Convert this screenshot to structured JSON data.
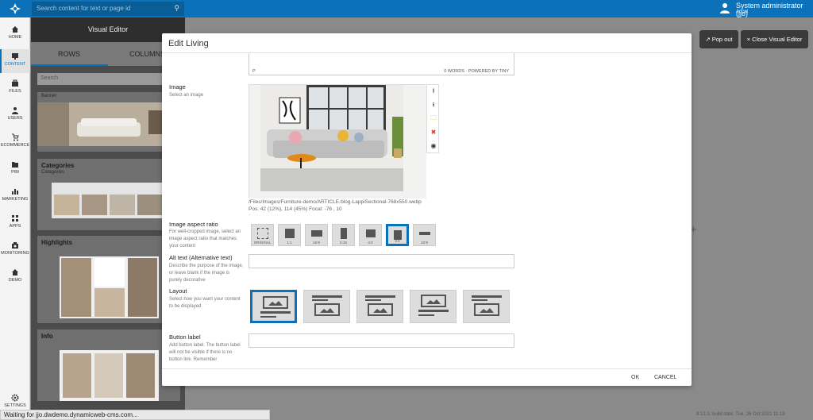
{
  "topbar": {
    "search_placeholder": "Search content for text or page id",
    "user_name": "System administrator (jjo)",
    "user_subtitle": "Angel"
  },
  "nav": [
    {
      "label": "HOME",
      "icon": "home-icon"
    },
    {
      "label": "CONTENT",
      "icon": "monitor-icon",
      "active": true
    },
    {
      "label": "FILES",
      "icon": "briefcase-icon"
    },
    {
      "label": "USERS",
      "icon": "user-icon"
    },
    {
      "label": "ECOMMERCE",
      "icon": "cart-icon"
    },
    {
      "label": "PIM",
      "icon": "folder-icon"
    },
    {
      "label": "MARKETING",
      "icon": "bar-chart-icon"
    },
    {
      "label": "APPS",
      "icon": "grid-icon"
    },
    {
      "label": "MONITORING",
      "icon": "camera-icon"
    },
    {
      "label": "DEMO",
      "icon": "home-icon"
    },
    {
      "label": "SETTINGS",
      "icon": "gear-icon"
    }
  ],
  "visual_editor": {
    "title": "Visual Editor",
    "tabs": [
      "ROWS",
      "COLUMNS"
    ],
    "search_placeholder": "Search",
    "cards": [
      {
        "title": "",
        "subtitle": "Banner"
      },
      {
        "title": "Categories",
        "subtitle": "Categories"
      },
      {
        "title": "Highlights",
        "subtitle": ""
      },
      {
        "title": "Info",
        "subtitle": ""
      }
    ]
  },
  "header_buttons": {
    "popout": "Pop out",
    "close": "Close Visual Editor"
  },
  "modal": {
    "title": "Edit Living",
    "editor": {
      "p_tag": "P",
      "counter": "0 WORDS · POWERED BY TINY"
    },
    "image": {
      "label": "Image",
      "desc": "Select an image",
      "path": "/Files/Images/Furniture-demo/ARTICLE-blog-LappiSectional-768x550.webp",
      "pos": "Pos: 42 (12%), 114 (45%) Focal: -76 , 10",
      "dash": "-"
    },
    "aspect": {
      "label": "Image aspect ratio",
      "desc": "For well-cropped image, select an image aspect ratio that matches your content",
      "options": [
        "ORIGINAL",
        "1:1",
        "16:9",
        "5:15",
        "4:3",
        "3:4",
        "22:9"
      ],
      "selected_index": 5
    },
    "alt": {
      "label": "Alt text (Alternative text)",
      "desc": "Describe the purpose of the image, or leave blank if the image is purely decorative"
    },
    "layout": {
      "label": "Layout",
      "desc": "Select how you want your content to be displayed",
      "selected_index": 0
    },
    "button_label": {
      "label": "Button label",
      "desc": "Add button label. The button label will not be visible if there is no button link. Remember"
    },
    "ok": "OK",
    "cancel": "CANCEL"
  },
  "build": "9.12.3, build date: Tue, 26 Oct 2021 11:19",
  "status": "Waiting for jjo.dwdemo.dynamicweb-cms.com...",
  "colors": {
    "accent": "#0b72b9"
  }
}
